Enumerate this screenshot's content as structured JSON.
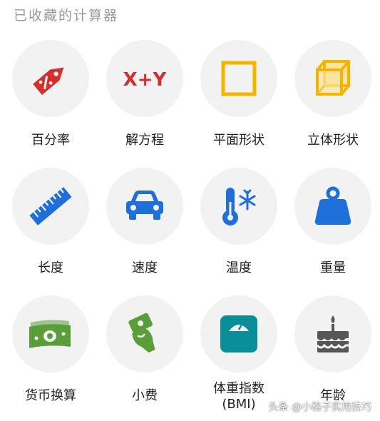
{
  "section": {
    "title": "已收藏的计算器"
  },
  "calculators": [
    {
      "label": "百分率",
      "icon": "percentage-tag-icon",
      "color": "#d32f2f"
    },
    {
      "label": "解方程",
      "icon": "equation-xy-icon",
      "color": "#d32f2f"
    },
    {
      "label": "平面形状",
      "icon": "square-shape-icon",
      "color": "#f4b400"
    },
    {
      "label": "立体形状",
      "icon": "cube-shape-icon",
      "color": "#f4b400"
    },
    {
      "label": "长度",
      "icon": "ruler-icon",
      "color": "#1e6fd9"
    },
    {
      "label": "速度",
      "icon": "car-icon",
      "color": "#1e6fd9"
    },
    {
      "label": "温度",
      "icon": "thermometer-snowflake-icon",
      "color": "#1e6fd9"
    },
    {
      "label": "重量",
      "icon": "weight-icon",
      "color": "#1e6fd9"
    },
    {
      "label": "货币换算",
      "icon": "money-icon",
      "color": "#5a9e3a"
    },
    {
      "label": "小费",
      "icon": "tip-hand-icon",
      "color": "#5a9e3a"
    },
    {
      "label": "体重指数\n(BMI)",
      "icon": "scale-icon",
      "color": "#0a8e96"
    },
    {
      "label": "年龄",
      "icon": "birthday-cake-icon",
      "color": "#555555"
    }
  ],
  "icon_text": {
    "equation": "X+Y"
  },
  "watermark": {
    "text": "头条 @小格子实用技巧"
  }
}
